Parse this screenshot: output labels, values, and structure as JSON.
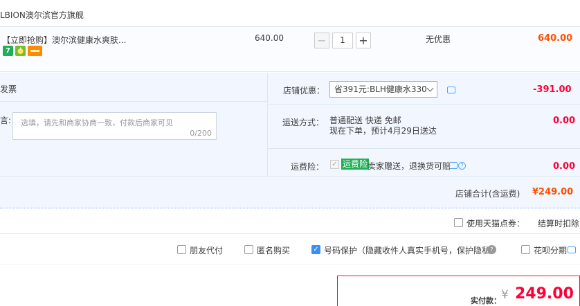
{
  "shop": {
    "name": "LBION澳尔滨官方旗舰"
  },
  "item": {
    "title": "【立即抢购】澳尔滨健康水爽肤...",
    "badges": [
      "7",
      "fruit-icon",
      "card-icon"
    ],
    "unit_price": "640.00",
    "quantity": "1",
    "discount": "无优惠",
    "total": "640.00"
  },
  "invoice": {
    "label": "发票"
  },
  "message": {
    "label": "言:",
    "placeholder": "选填，请先和商家协商一致，付款后商家可见",
    "count": "0/200"
  },
  "coupon": {
    "label": "店铺优惠：",
    "selected": "省391元:BLH健康水330",
    "amount": "-391.00"
  },
  "shipping": {
    "label": "运送方式：",
    "line1": "普通配送 快递 免邮",
    "line2": "现在下单，预计4月29日送达",
    "amount": "0.00"
  },
  "insurance": {
    "label": "运费险：",
    "tag": "运费险",
    "text": "卖家赠送，退换货可赔",
    "amount": "0.00"
  },
  "shop_total": {
    "label": "店铺合计(含运费)",
    "amount": "¥249.00"
  },
  "points": {
    "label": "使用天猫点券：",
    "note": "结算时扣除"
  },
  "services": [
    {
      "label": "朋友代付",
      "checked": false
    },
    {
      "label": "匿名购买",
      "checked": false
    },
    {
      "label": "号码保护（隐藏收件人真实手机号，保护隐私）",
      "checked": true
    },
    {
      "label": "花呗分期",
      "checked": false
    }
  ],
  "payment": {
    "label": "实付款：",
    "symbol": "¥",
    "amount": "249.00"
  },
  "colors": {
    "accent": "#ff5000",
    "red": "#ff0036",
    "panel": "#f2f7ff",
    "link": "#3a8ef6"
  }
}
